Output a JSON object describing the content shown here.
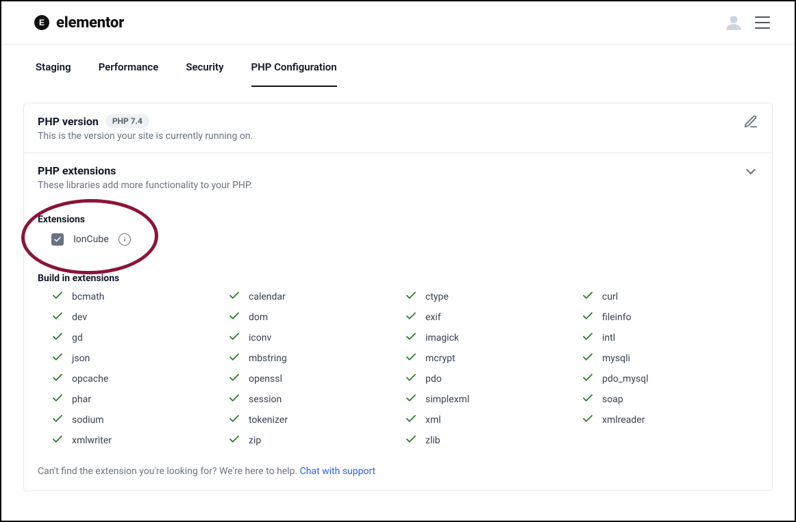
{
  "brand": {
    "name": "elementor"
  },
  "tabs": {
    "items": [
      "Staging",
      "Performance",
      "Security",
      "PHP Configuration"
    ],
    "active": 3
  },
  "phpVersion": {
    "title": "PHP version",
    "badge": "PHP 7.4",
    "subtitle": "This is the version your site is currently running on."
  },
  "phpExtensions": {
    "title": "PHP extensions",
    "subtitle": "These libraries add more functionality to your PHP.",
    "list_title": "Extensions",
    "toggle_items": [
      {
        "name": "IonCube",
        "checked": true
      }
    ],
    "builtin_title": "Build in extensions",
    "builtin": [
      "bcmath",
      "calendar",
      "ctype",
      "curl",
      "dev",
      "dom",
      "exif",
      "fileinfo",
      "gd",
      "iconv",
      "imagick",
      "intl",
      "json",
      "mbstring",
      "mcrypt",
      "mysqli",
      "opcache",
      "openssl",
      "pdo",
      "pdo_mysql",
      "phar",
      "session",
      "simplexml",
      "soap",
      "sodium",
      "tokenizer",
      "xml",
      "xmlreader",
      "xmlwriter",
      "zip",
      "zlib"
    ],
    "help_text": "Can't find the extension you're looking for? We're here to help. ",
    "help_link": "Chat with support"
  },
  "annotations": {
    "ellipse_hint": "IonCube extension highlighted"
  }
}
